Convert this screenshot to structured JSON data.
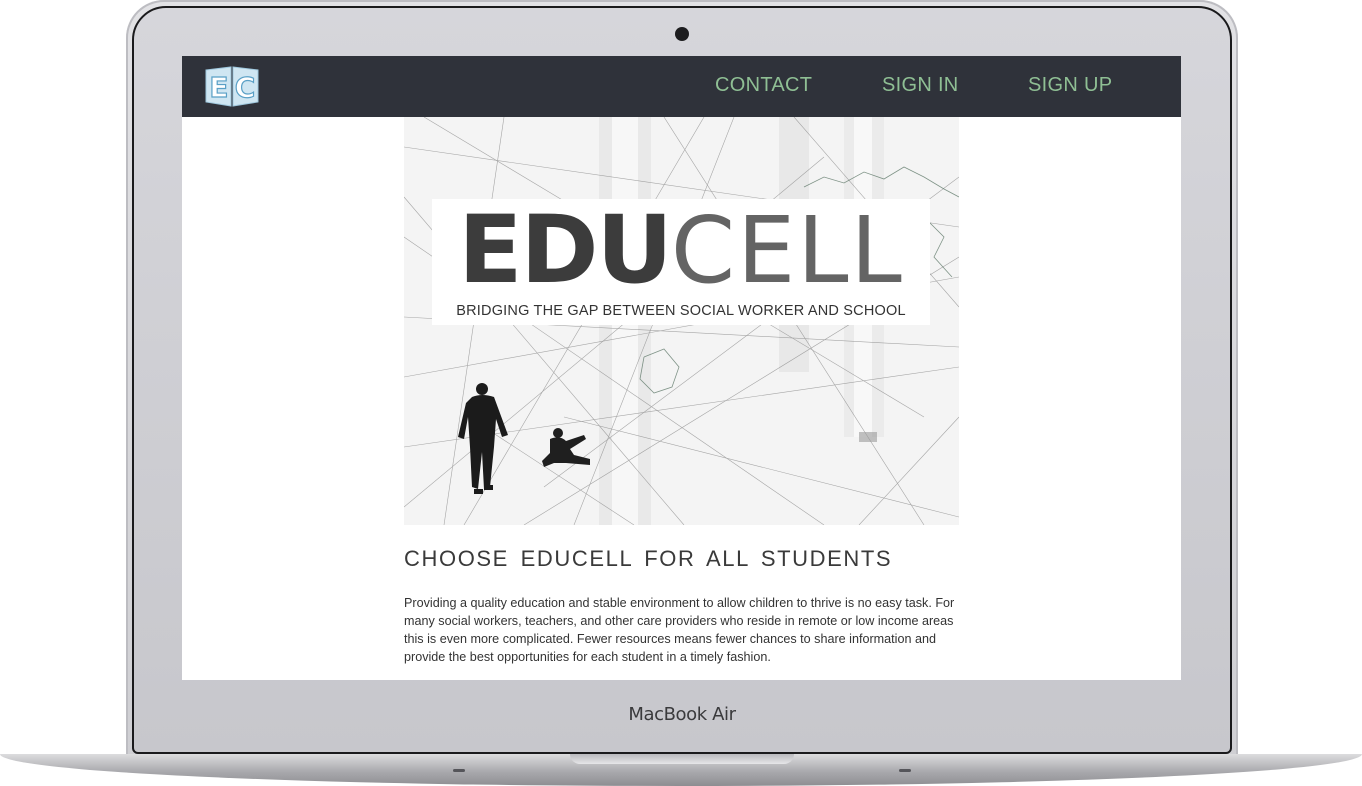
{
  "device": {
    "brand_label": "MacBook Air"
  },
  "navbar": {
    "logo_text": "EC",
    "links": [
      {
        "label": "CONTACT"
      },
      {
        "label": "SIGN IN"
      },
      {
        "label": "SIGN UP"
      }
    ],
    "background_color": "#2f323a",
    "link_color": "#8fbf94"
  },
  "hero": {
    "title_bold": "EDU",
    "title_light": "CELL",
    "subtitle": "BRIDGING THE GAP BETWEEN SOCIAL WORKER AND SCHOOL"
  },
  "content": {
    "heading": "CHOOSE EDUCELL FOR ALL STUDENTS",
    "paragraph": "Providing a quality education and stable environment to allow children to thrive is no easy task. For many social workers, teachers, and other care providers who reside in remote or low income areas this is even more complicated. Fewer resources means fewer chances to share information and provide the best opportunities for each student in a timely fashion."
  }
}
